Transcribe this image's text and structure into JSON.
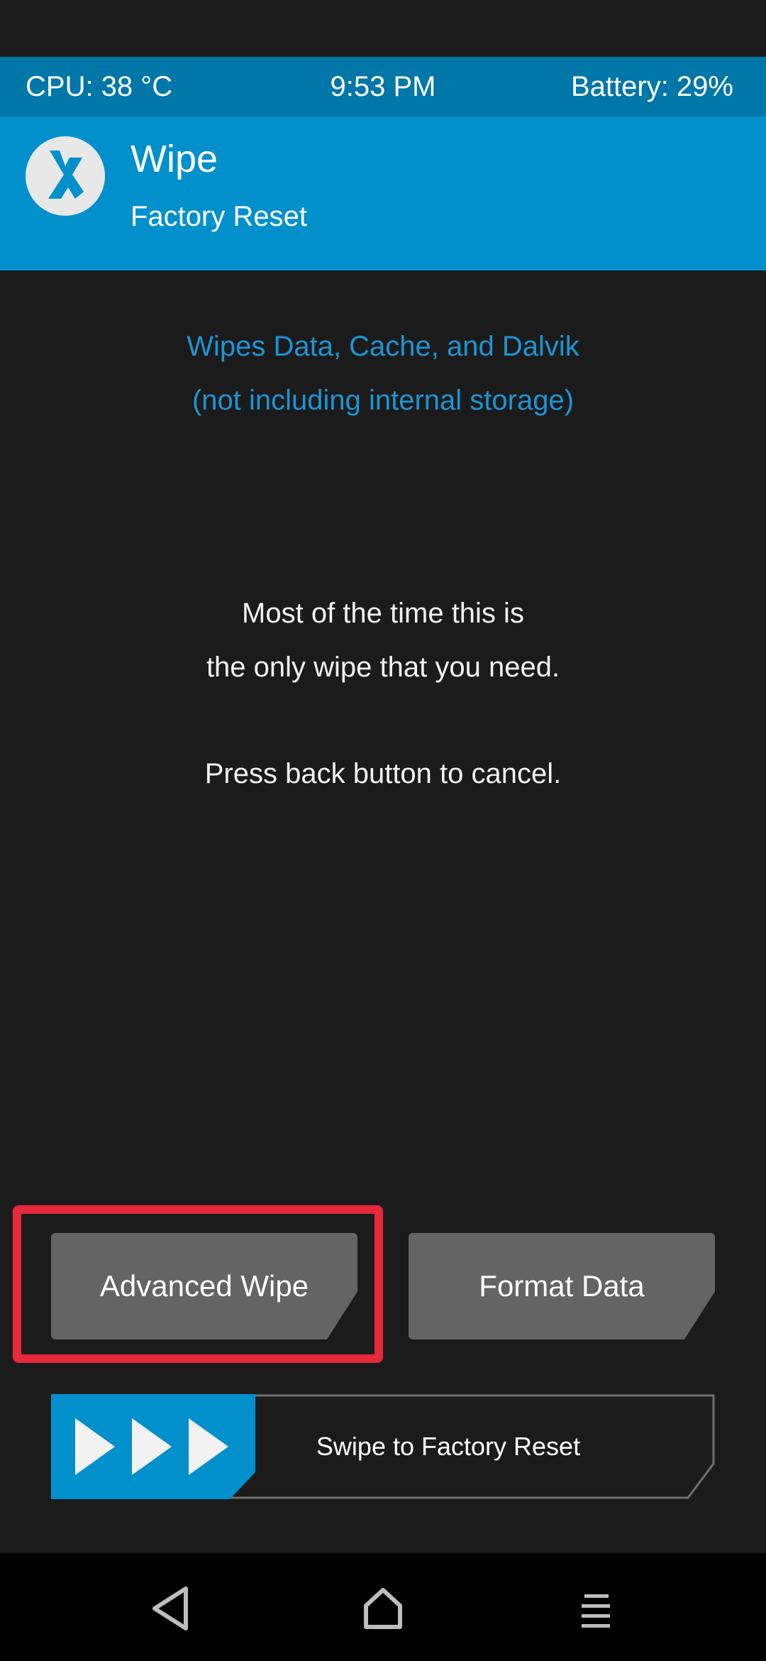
{
  "status_bar": {
    "cpu": "CPU: 38 °C",
    "time": "9:53 PM",
    "battery": "Battery: 29%"
  },
  "header": {
    "title": "Wipe",
    "subtitle": "Factory Reset",
    "logo_icon": "twrp-logo-icon"
  },
  "info": {
    "line1": "Wipes Data, Cache, and Dalvik",
    "line2": "(not including internal storage)"
  },
  "message": {
    "line1": "Most of the time this is",
    "line2": "the only wipe that you need.",
    "line3": "Press back button to cancel."
  },
  "buttons": {
    "advanced_wipe": "Advanced Wipe",
    "format_data": "Format Data"
  },
  "swipe": {
    "label": "Swipe to Factory Reset",
    "icon": "triple-play-arrows-icon"
  },
  "navigation": {
    "back_icon": "back-triangle-icon",
    "home_icon": "home-icon",
    "menu_icon": "menu-lines-icon"
  },
  "colors": {
    "status_bar": "#0176a8",
    "header": "#0190cc",
    "accent_text": "#1e94d4",
    "button": "#646464",
    "highlight": "#e8283b",
    "background": "#1b1b1b"
  }
}
